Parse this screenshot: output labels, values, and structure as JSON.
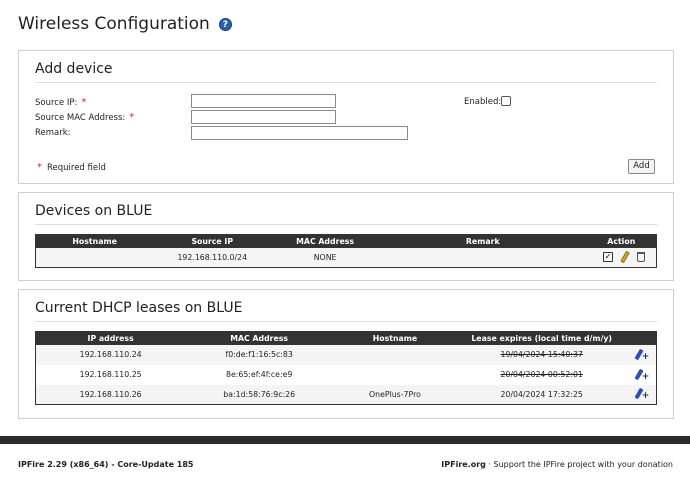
{
  "page": {
    "title": "Wireless Configuration",
    "help_icon": "?"
  },
  "add_device": {
    "title": "Add device",
    "source_ip_label": "Source IP:",
    "source_mac_label": "Source MAC Address:",
    "remark_label": "Remark:",
    "enabled_label": "Enabled:",
    "required_marker": "*",
    "required_note": "Required field",
    "add_button": "Add",
    "source_ip_value": "",
    "source_mac_value": "",
    "remark_value": ""
  },
  "devices": {
    "title": "Devices on BLUE",
    "headers": [
      "Hostname",
      "Source IP",
      "MAC Address",
      "Remark",
      "Action"
    ],
    "rows": [
      {
        "hostname": "",
        "source_ip": "192.168.110.0/24",
        "mac": "NONE",
        "remark": ""
      }
    ],
    "action_icons": [
      "checkbox-icon",
      "pencil-icon",
      "trash-icon"
    ]
  },
  "leases": {
    "title": "Current DHCP leases on BLUE",
    "headers": [
      "IP address",
      "MAC Address",
      "Hostname",
      "Lease expires (local time d/m/y)"
    ],
    "rows": [
      {
        "ip": "192.168.110.24",
        "mac": "f0:de:f1:16:5c:83",
        "hostname": "",
        "expires": "19/04/2024 15:40:37",
        "expired": true
      },
      {
        "ip": "192.168.110.25",
        "mac": "8e:65:ef:4f:ce:e9",
        "hostname": "",
        "expires": "20/04/2024 00:52:01",
        "expired": true
      },
      {
        "ip": "192.168.110.26",
        "mac": "ba:1d:58:76:9c:26",
        "hostname": "OnePlus-7Pro",
        "expires": "20/04/2024 17:32:25",
        "expired": false
      }
    ]
  },
  "footer": {
    "version": "IPFire 2.29 (x86_64) - Core-Update 185",
    "site": "IPFire.org",
    "separator": " · ",
    "support_text": "Support the IPFire project with your donation"
  },
  "colors": {
    "table_header": "#333333",
    "required": "#dd2222",
    "help_icon": "#2a5fb0"
  }
}
